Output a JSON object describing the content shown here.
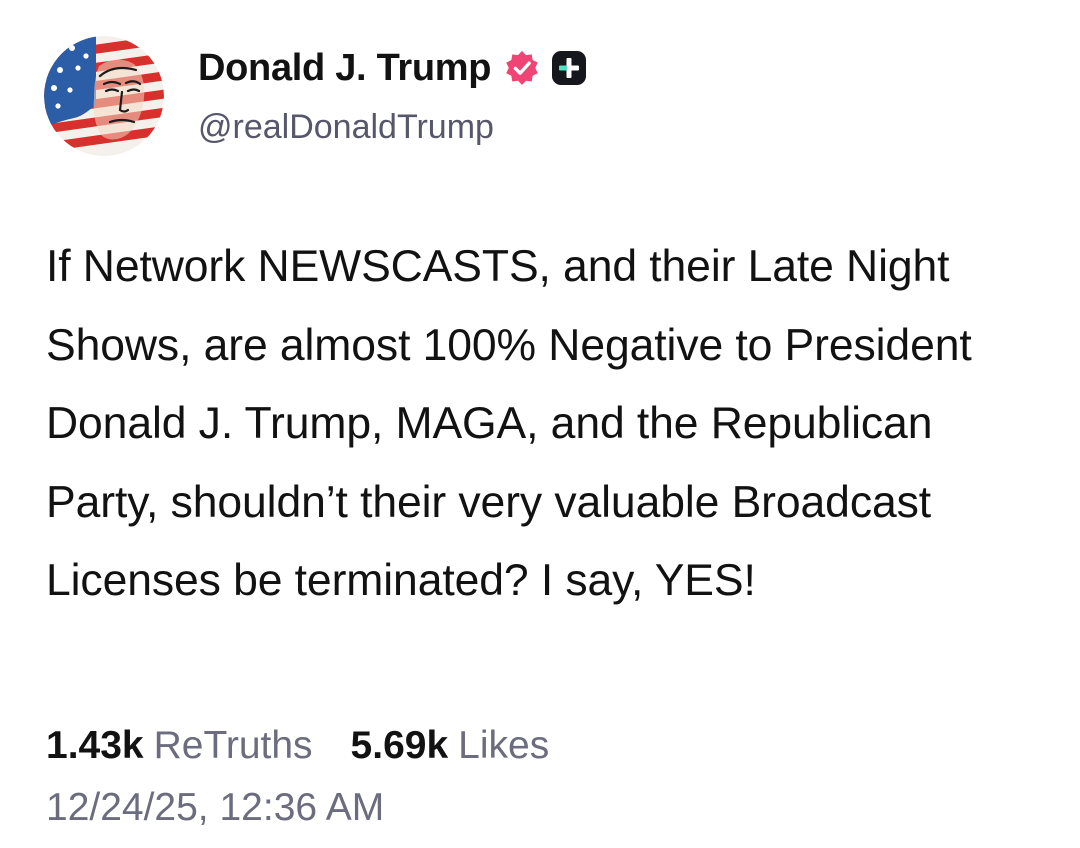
{
  "author": {
    "display_name": "Donald J. Trump",
    "handle": "@realDonaldTrump",
    "avatar_icon": "flag-portrait-avatar",
    "verified_icon": "verified-badge-icon",
    "plus_icon": "truth-social-plus-icon"
  },
  "post": {
    "text": "If Network NEWSCASTS, and their Late Night Shows, are almost 100% Negative to President Donald J. Trump, MAGA, and the Republican Party, shouldn’t their very valuable Broadcast Licenses be terminated? I say, YES!"
  },
  "stats": {
    "retruths_count": "1.43k",
    "retruths_label": "ReTruths",
    "likes_count": "5.69k",
    "likes_label": "Likes"
  },
  "timestamp": "12/24/25, 12:36 AM",
  "colors": {
    "verified": "#ef4474",
    "plus_badge": "#16161d",
    "plus_accent": "#4fe3c1",
    "muted_text": "#6b6d7f"
  }
}
